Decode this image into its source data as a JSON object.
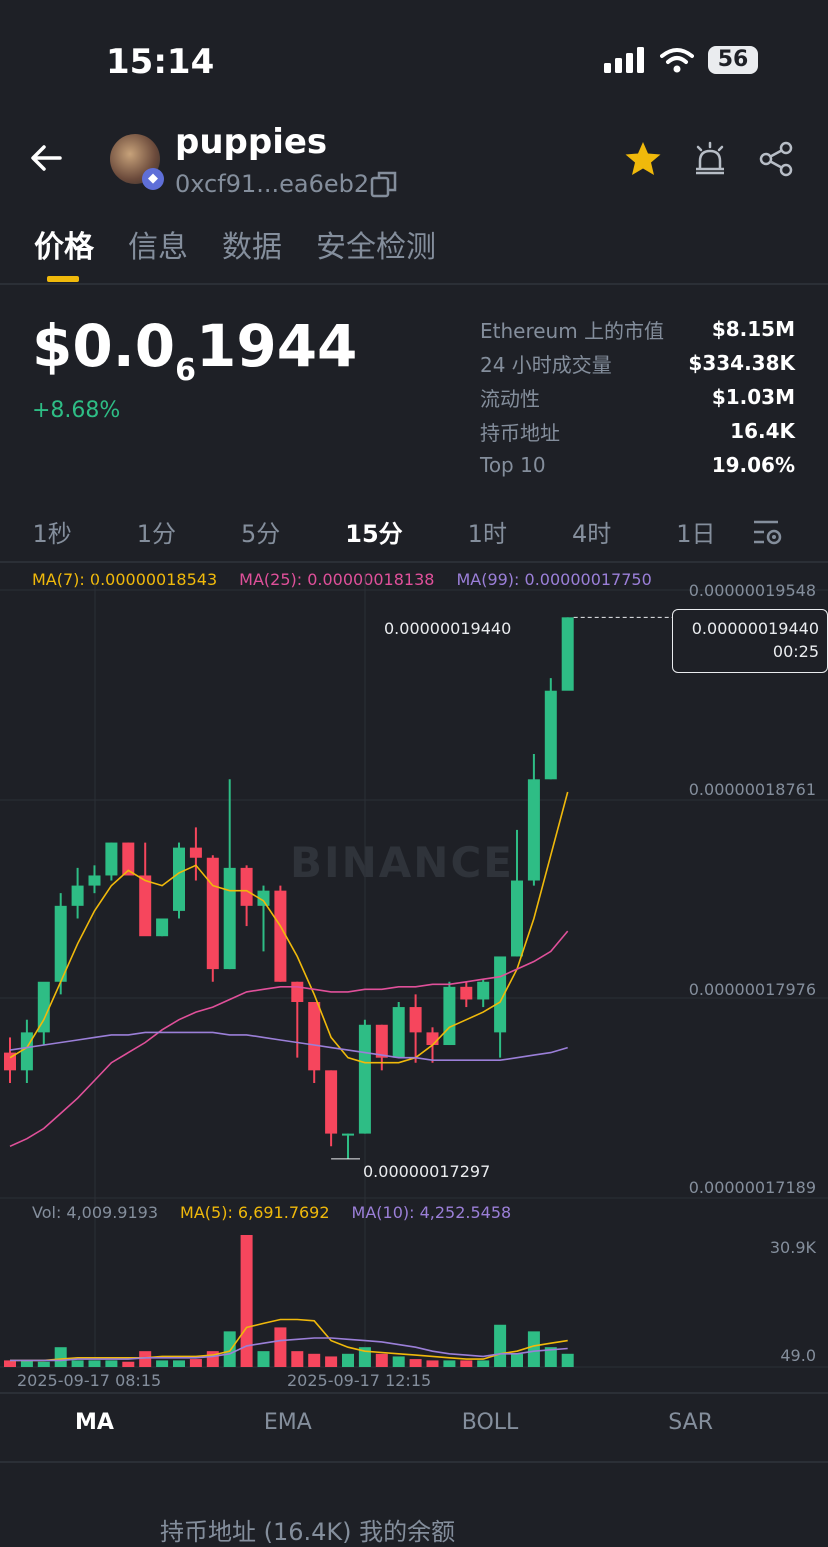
{
  "status": {
    "time": "15:14",
    "battery": "56"
  },
  "token": {
    "name": "puppies",
    "address": "0xcf91...ea6eb2"
  },
  "tabs": [
    {
      "label": "价格",
      "active": true
    },
    {
      "label": "信息"
    },
    {
      "label": "数据"
    },
    {
      "label": "安全检测"
    }
  ],
  "price": {
    "prefix": "$0.0",
    "zeros": "6",
    "digits": "1944",
    "change": "+8.68%"
  },
  "stats": [
    {
      "label": "Ethereum 上的市值",
      "value": "$8.15M"
    },
    {
      "label": "24 小时成交量",
      "value": "$334.38K"
    },
    {
      "label": "流动性",
      "value": "$1.03M"
    },
    {
      "label": "持币地址",
      "value": "16.4K"
    },
    {
      "label": "Top 10",
      "value": "19.06%"
    }
  ],
  "intervals": [
    "1秒",
    "1分",
    "5分",
    "15分",
    "1时",
    "4时",
    "1日"
  ],
  "active_interval": "15分",
  "ma_legend": {
    "ma7": "MA(7): 0.00000018543",
    "ma25": "MA(25): 0.00000018138",
    "ma99": "MA(99): 0.00000017750"
  },
  "vol_legend": {
    "vol": "Vol: 4,009.9193",
    "ma5": "MA(5): 6,691.7692",
    "ma10": "MA(10): 4,252.5458"
  },
  "price_axis": [
    "0.00000019548",
    "0.00000018761",
    "0.00000017976",
    "0.00000017189"
  ],
  "vol_axis": [
    "30.9K",
    "49.0"
  ],
  "time_axis": [
    "2025-09-17 08:15",
    "2025-09-17 12:15"
  ],
  "high_label": "0.00000019440",
  "low_label": "0.00000017297",
  "current_price_tag": {
    "price": "0.00000019440",
    "countdown": "00:25"
  },
  "watermark": "BINANCE",
  "bottom_tabs": [
    "MA",
    "EMA",
    "BOLL",
    "SAR"
  ],
  "bottom_partial": "持币地址 (16.4K)  我的余额",
  "colors": {
    "up": "#2ebd85",
    "down": "#f6465d",
    "ma7": "#f0b90b",
    "ma25": "#e0509a",
    "ma99": "#9b7fd8"
  },
  "chart_data": {
    "type": "candlestick",
    "ylim": [
      1.7189e-07,
      1.9548e-07
    ],
    "candles": [
      {
        "o": 1.772,
        "h": 1.778,
        "l": 1.76,
        "c": 1.765
      },
      {
        "o": 1.765,
        "h": 1.785,
        "l": 1.76,
        "c": 1.78
      },
      {
        "o": 1.78,
        "h": 1.795,
        "l": 1.775,
        "c": 1.8
      },
      {
        "o": 1.8,
        "h": 1.835,
        "l": 1.795,
        "c": 1.83
      },
      {
        "o": 1.83,
        "h": 1.845,
        "l": 1.825,
        "c": 1.838
      },
      {
        "o": 1.838,
        "h": 1.846,
        "l": 1.835,
        "c": 1.842
      },
      {
        "o": 1.842,
        "h": 1.855,
        "l": 1.84,
        "c": 1.855
      },
      {
        "o": 1.855,
        "h": 1.855,
        "l": 1.85,
        "c": 1.842
      },
      {
        "o": 1.842,
        "h": 1.855,
        "l": 1.82,
        "c": 1.818
      },
      {
        "o": 1.818,
        "h": 1.825,
        "l": 1.818,
        "c": 1.825
      },
      {
        "o": 1.828,
        "h": 1.855,
        "l": 1.825,
        "c": 1.853
      },
      {
        "o": 1.853,
        "h": 1.861,
        "l": 1.84,
        "c": 1.849
      },
      {
        "o": 1.849,
        "h": 1.85,
        "l": 1.8,
        "c": 1.805
      },
      {
        "o": 1.805,
        "h": 1.88,
        "l": 1.805,
        "c": 1.845
      },
      {
        "o": 1.845,
        "h": 1.846,
        "l": 1.822,
        "c": 1.83
      },
      {
        "o": 1.83,
        "h": 1.838,
        "l": 1.812,
        "c": 1.836
      },
      {
        "o": 1.836,
        "h": 1.838,
        "l": 1.8,
        "c": 1.8
      },
      {
        "o": 1.8,
        "h": 1.8,
        "l": 1.77,
        "c": 1.792
      },
      {
        "o": 1.792,
        "h": 1.79,
        "l": 1.76,
        "c": 1.765
      },
      {
        "o": 1.765,
        "h": 1.765,
        "l": 1.735,
        "c": 1.74
      },
      {
        "o": 1.74,
        "h": 1.74,
        "l": 1.73,
        "c": 1.74
      },
      {
        "o": 1.74,
        "h": 1.785,
        "l": 1.74,
        "c": 1.783
      },
      {
        "o": 1.783,
        "h": 1.783,
        "l": 1.765,
        "c": 1.77
      },
      {
        "o": 1.77,
        "h": 1.792,
        "l": 1.77,
        "c": 1.79
      },
      {
        "o": 1.79,
        "h": 1.795,
        "l": 1.768,
        "c": 1.78
      },
      {
        "o": 1.78,
        "h": 1.782,
        "l": 1.768,
        "c": 1.775
      },
      {
        "o": 1.775,
        "h": 1.8,
        "l": 1.775,
        "c": 1.798
      },
      {
        "o": 1.798,
        "h": 1.8,
        "l": 1.79,
        "c": 1.793
      },
      {
        "o": 1.793,
        "h": 1.801,
        "l": 1.79,
        "c": 1.8
      },
      {
        "o": 1.78,
        "h": 1.81,
        "l": 1.77,
        "c": 1.81
      },
      {
        "o": 1.81,
        "h": 1.86,
        "l": 1.81,
        "c": 1.84
      },
      {
        "o": 1.84,
        "h": 1.89,
        "l": 1.838,
        "c": 1.88
      },
      {
        "o": 1.88,
        "h": 1.92,
        "l": 1.88,
        "c": 1.915
      },
      {
        "o": 1.915,
        "h": 1.944,
        "l": 1.92,
        "c": 1.944
      }
    ],
    "ma7": [
      1.77,
      1.774,
      1.785,
      1.8,
      1.815,
      1.828,
      1.838,
      1.844,
      1.84,
      1.838,
      1.843,
      1.846,
      1.838,
      1.836,
      1.836,
      1.832,
      1.822,
      1.81,
      1.795,
      1.778,
      1.77,
      1.768,
      1.768,
      1.768,
      1.77,
      1.775,
      1.782,
      1.785,
      1.788,
      1.792,
      1.805,
      1.825,
      1.85,
      1.875
    ],
    "ma25": [
      1.735,
      1.738,
      1.742,
      1.748,
      1.754,
      1.761,
      1.768,
      1.772,
      1.776,
      1.781,
      1.785,
      1.788,
      1.79,
      1.793,
      1.796,
      1.797,
      1.798,
      1.798,
      1.797,
      1.796,
      1.796,
      1.797,
      1.797,
      1.798,
      1.798,
      1.799,
      1.799,
      1.8,
      1.801,
      1.802,
      1.805,
      1.808,
      1.812,
      1.82
    ],
    "ma99": [
      1.773,
      1.774,
      1.775,
      1.776,
      1.777,
      1.778,
      1.779,
      1.779,
      1.78,
      1.78,
      1.78,
      1.78,
      1.78,
      1.779,
      1.779,
      1.778,
      1.777,
      1.776,
      1.775,
      1.774,
      1.773,
      1.772,
      1.771,
      1.77,
      1.77,
      1.769,
      1.769,
      1.769,
      1.769,
      1.769,
      1.77,
      1.771,
      1.772,
      1.774
    ],
    "volumes": [
      0.05,
      0.05,
      0.04,
      0.15,
      0.05,
      0.05,
      0.05,
      0.04,
      0.12,
      0.05,
      0.05,
      0.06,
      0.12,
      0.27,
      1.0,
      0.12,
      0.3,
      0.12,
      0.1,
      0.08,
      0.1,
      0.15,
      0.1,
      0.08,
      0.06,
      0.05,
      0.05,
      0.05,
      0.05,
      0.32,
      0.1,
      0.27,
      0.15,
      0.1
    ],
    "vol_ma5": [
      0.05,
      0.05,
      0.05,
      0.06,
      0.07,
      0.07,
      0.07,
      0.07,
      0.07,
      0.08,
      0.08,
      0.08,
      0.09,
      0.12,
      0.3,
      0.33,
      0.36,
      0.36,
      0.35,
      0.2,
      0.15,
      0.12,
      0.11,
      0.1,
      0.09,
      0.08,
      0.07,
      0.06,
      0.06,
      0.1,
      0.12,
      0.16,
      0.18,
      0.2
    ],
    "vol_ma10": [
      0.05,
      0.05,
      0.05,
      0.05,
      0.06,
      0.06,
      0.06,
      0.06,
      0.07,
      0.07,
      0.07,
      0.07,
      0.08,
      0.1,
      0.16,
      0.18,
      0.2,
      0.21,
      0.22,
      0.22,
      0.21,
      0.2,
      0.19,
      0.17,
      0.15,
      0.12,
      0.1,
      0.09,
      0.08,
      0.1,
      0.1,
      0.12,
      0.13,
      0.14
    ]
  }
}
